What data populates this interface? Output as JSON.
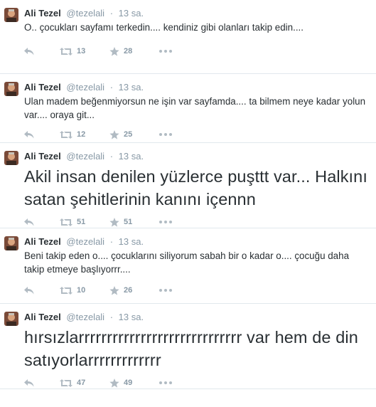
{
  "tweets": [
    {
      "name": "Ali Tezel",
      "handle": "@tezelali",
      "dot": "·",
      "time": "13 sa.",
      "text": "O.. çocukları sayfamı terkedin.... kendiniz gibi olanları takip edin....",
      "retweets": "13",
      "favorites": "28"
    },
    {
      "name": "Ali Tezel",
      "handle": "@tezelali",
      "dot": "·",
      "time": "13 sa.",
      "text": "Ulan madem beğenmiyorsun ne işin var sayfamda.... ta bilmem neye kadar yolun var.... oraya git...",
      "retweets": "12",
      "favorites": "25"
    },
    {
      "name": "Ali Tezel",
      "handle": "@tezelali",
      "dot": "·",
      "time": "13 sa.",
      "text": "Akil insan denilen yüzlerce puşttt var... Halkını satan şehitlerinin kanını içennn",
      "retweets": "51",
      "favorites": "51"
    },
    {
      "name": "Ali Tezel",
      "handle": "@tezelali",
      "dot": "·",
      "time": "13 sa.",
      "text": "Beni takip eden o.... çocuklarını siliyorum sabah bir o kadar o.... çocuğu daha takip etmeye başlıyorrr....",
      "retweets": "10",
      "favorites": "26"
    },
    {
      "name": "Ali Tezel",
      "handle": "@tezelali",
      "dot": "·",
      "time": "13 sa.",
      "text": "hırsızlarrrrrrrrrrrrrrrrrrrrrrrrrrrrr var hem de din satıyorlarrrrrrrrrrrrr",
      "retweets": "47",
      "favorites": "49"
    }
  ],
  "icons": {
    "reply": "reply-icon",
    "retweet": "retweet-icon",
    "favorite": "star-icon",
    "more": "more-icon"
  },
  "colors": {
    "name": "#292f33",
    "meta": "#8899a6",
    "icon": "#b1bbc3",
    "divider": "#e1e8ed"
  }
}
